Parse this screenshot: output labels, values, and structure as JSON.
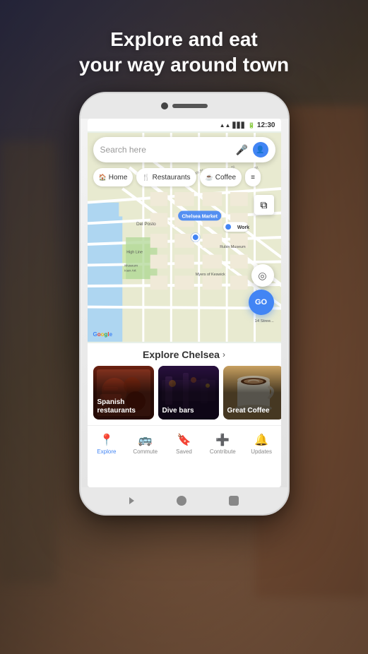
{
  "hero": {
    "line1": "Explore and eat",
    "line2": "your way around town"
  },
  "phone": {
    "status_bar": {
      "time": "12:30"
    },
    "search": {
      "placeholder": "Search here"
    },
    "chips": [
      {
        "icon": "🏠",
        "label": "Home"
      },
      {
        "icon": "🍴",
        "label": "Restaurants"
      },
      {
        "icon": "☕",
        "label": "Coffee"
      }
    ],
    "map": {
      "labels": [
        {
          "text": "Chelsea Market",
          "type": "poi"
        },
        {
          "text": "Work",
          "type": "pin"
        },
        {
          "text": "Rubin Museum",
          "type": "label"
        },
        {
          "text": "Myers of Keswick",
          "type": "label"
        },
        {
          "text": "Del Posto",
          "type": "label"
        },
        {
          "text": "High Line",
          "type": "label"
        },
        {
          "text": "Museum of American Art",
          "type": "label"
        },
        {
          "text": "14 Stree...",
          "type": "label"
        },
        {
          "text": "GO",
          "type": "button"
        }
      ],
      "google_logo": "Google"
    },
    "explore": {
      "title": "Explore Chelsea",
      "cards": [
        {
          "label": "Spanish restaurants",
          "color_top": "#8B2500",
          "color_bottom": "#5a1500"
        },
        {
          "label": "Dive bars",
          "color_top": "#1a1a2e",
          "color_bottom": "#2d2d4e"
        },
        {
          "label": "Great Coffee",
          "color_top": "#c8a060",
          "color_bottom": "#8b6030"
        }
      ]
    },
    "bottom_nav": [
      {
        "icon": "📍",
        "label": "Explore",
        "active": true
      },
      {
        "icon": "🚌",
        "label": "Commute",
        "active": false
      },
      {
        "icon": "🔖",
        "label": "Saved",
        "active": false
      },
      {
        "icon": "➕",
        "label": "Contribute",
        "active": false
      },
      {
        "icon": "🔔",
        "label": "Updates",
        "active": false
      }
    ]
  }
}
